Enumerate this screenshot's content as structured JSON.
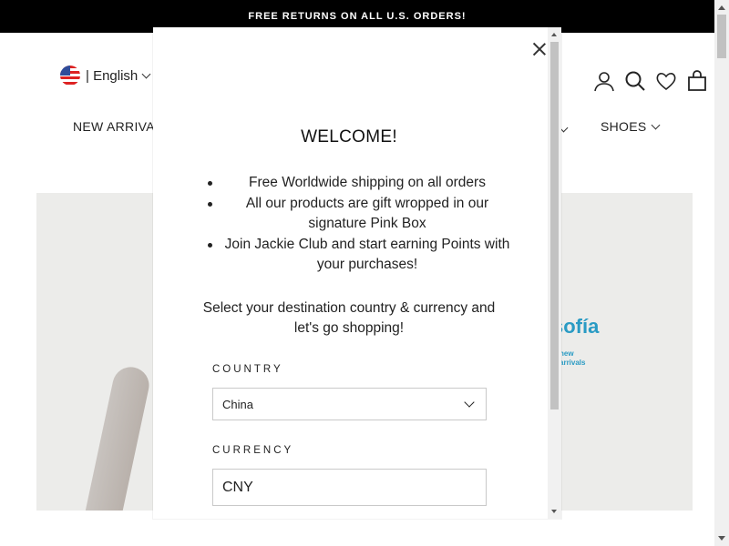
{
  "announcement": "FREE RETURNS ON ALL U.S. ORDERS!",
  "header": {
    "language": "| English",
    "nav_new_arrivals": "NEW ARRIVAL",
    "nav_shoes": "SHOES",
    "icons": [
      "account-icon",
      "search-icon",
      "wishlist-icon",
      "cart-icon"
    ]
  },
  "hero": {
    "brand": "sofía",
    "sub_line1": "new",
    "sub_line2": "arrivals"
  },
  "modal": {
    "title": "WELCOME!",
    "bullets": [
      "Free Worldwide shipping on all orders",
      "All our products are gift wropped in our signature Pink Box",
      "Join Jackie Club and start earning Points with your purchases!"
    ],
    "select_text": "Select your destination country & currency and let's go shopping!",
    "country_label": "COUNTRY",
    "country_value": "China",
    "currency_label": "CURRENCY",
    "currency_value": "CNY"
  }
}
